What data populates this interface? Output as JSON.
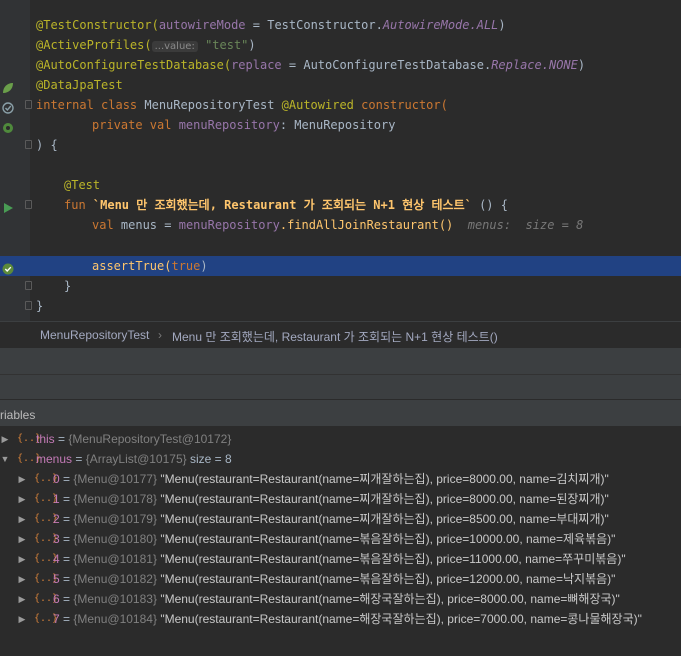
{
  "code": {
    "line1": {
      "ann": "@TestConstructor(",
      "param": "autowireMode",
      "eq": " = ",
      "cls": "TestConstructor.",
      "val": "AutowireMode.ALL",
      "close": ")"
    },
    "line2": {
      "ann": "@ActiveProfiles(",
      "hint": "...value:",
      "str": "\"test\"",
      "close": ")"
    },
    "line3": {
      "ann": "@AutoConfigureTestDatabase(",
      "param": "replace",
      "eq": " = ",
      "cls": "AutoConfigureTestDatabase.",
      "val": "Replace.NONE",
      "close": ")"
    },
    "line4": {
      "ann": "@DataJpaTest"
    },
    "line5": {
      "kw1": "internal class ",
      "cls": "MenuRepositoryTest ",
      "ann": "@Autowired ",
      "kw2": "constructor("
    },
    "line6": {
      "kw": "private val ",
      "prop": "menuRepository",
      "rest": ": MenuRepository"
    },
    "line7": {
      "text": ") {"
    },
    "line8": {
      "ann": "@Test"
    },
    "line9": {
      "kw": "fun ",
      "fn": "`Menu 만 조회했는데, Restaurant 가 조회되는 N+1 현상 테스트`",
      "rest": " () {"
    },
    "line10": {
      "kw": "val ",
      "name": "menus",
      "eq": " = ",
      "prop": "menuRepository",
      "rest": ".findAllJoinRestaurant()",
      "inline": "menus:  size = 8"
    },
    "line11": {
      "fn": "assertTrue(",
      "kw": "true",
      "close": ")"
    },
    "line12": {
      "text": "}"
    },
    "line13": {
      "text": "}"
    }
  },
  "breadcrumb": {
    "class_name": "MenuRepositoryTest",
    "separator": "›",
    "method_name": "Menu 만 조회했는데, Restaurant 가 조회되는 N+1 현상 테스트()"
  },
  "variables": {
    "title": "riables",
    "this_row": {
      "name": "this",
      "eq": " = ",
      "type": "{MenuRepositoryTest@10172}"
    },
    "menus_row": {
      "name": "menus",
      "eq": " = ",
      "type": "{ArrayList@10175}",
      "size": "  size = 8"
    },
    "items": [
      {
        "index": "0",
        "type": "{Menu@10177}",
        "value": "\"Menu(restaurant=Restaurant(name=찌개잘하는집), price=8000.00, name=김치찌개)\""
      },
      {
        "index": "1",
        "type": "{Menu@10178}",
        "value": "\"Menu(restaurant=Restaurant(name=찌개잘하는집), price=8000.00, name=된장찌개)\""
      },
      {
        "index": "2",
        "type": "{Menu@10179}",
        "value": "\"Menu(restaurant=Restaurant(name=찌개잘하는집), price=8500.00, name=부대찌개)\""
      },
      {
        "index": "3",
        "type": "{Menu@10180}",
        "value": "\"Menu(restaurant=Restaurant(name=볶음잘하는집), price=10000.00, name=제육볶음)\""
      },
      {
        "index": "4",
        "type": "{Menu@10181}",
        "value": "\"Menu(restaurant=Restaurant(name=볶음잘하는집), price=11000.00, name=쭈꾸미볶음)\""
      },
      {
        "index": "5",
        "type": "{Menu@10182}",
        "value": "\"Menu(restaurant=Restaurant(name=볶음잘하는집), price=12000.00, name=낙지볶음)\""
      },
      {
        "index": "6",
        "type": "{Menu@10183}",
        "value": "\"Menu(restaurant=Restaurant(name=해장국잘하는집), price=8000.00, name=뼈해장국)\""
      },
      {
        "index": "7",
        "type": "{Menu@10184}",
        "value": "\"Menu(restaurant=Restaurant(name=해장국잘하는집), price=7000.00, name=콩나물해장국)\""
      }
    ]
  },
  "icons": {
    "gutter_spring": "spring-leaf-icon",
    "gutter_test_class": "test-passed-icon",
    "gutter_run": "run-test-icon",
    "gutter_pass": "test-passed-icon",
    "var_object": "object-icon",
    "var_expand": "expand-arrow-icon"
  },
  "colors": {
    "editor_bg": "#2b2b2b",
    "highlight_line": "#214283",
    "annotation": "#bbb529",
    "keyword": "#cc7832",
    "function": "#ffc66d",
    "string": "#6a8759",
    "property": "#9876aa",
    "var_name": "#c37ab6"
  }
}
